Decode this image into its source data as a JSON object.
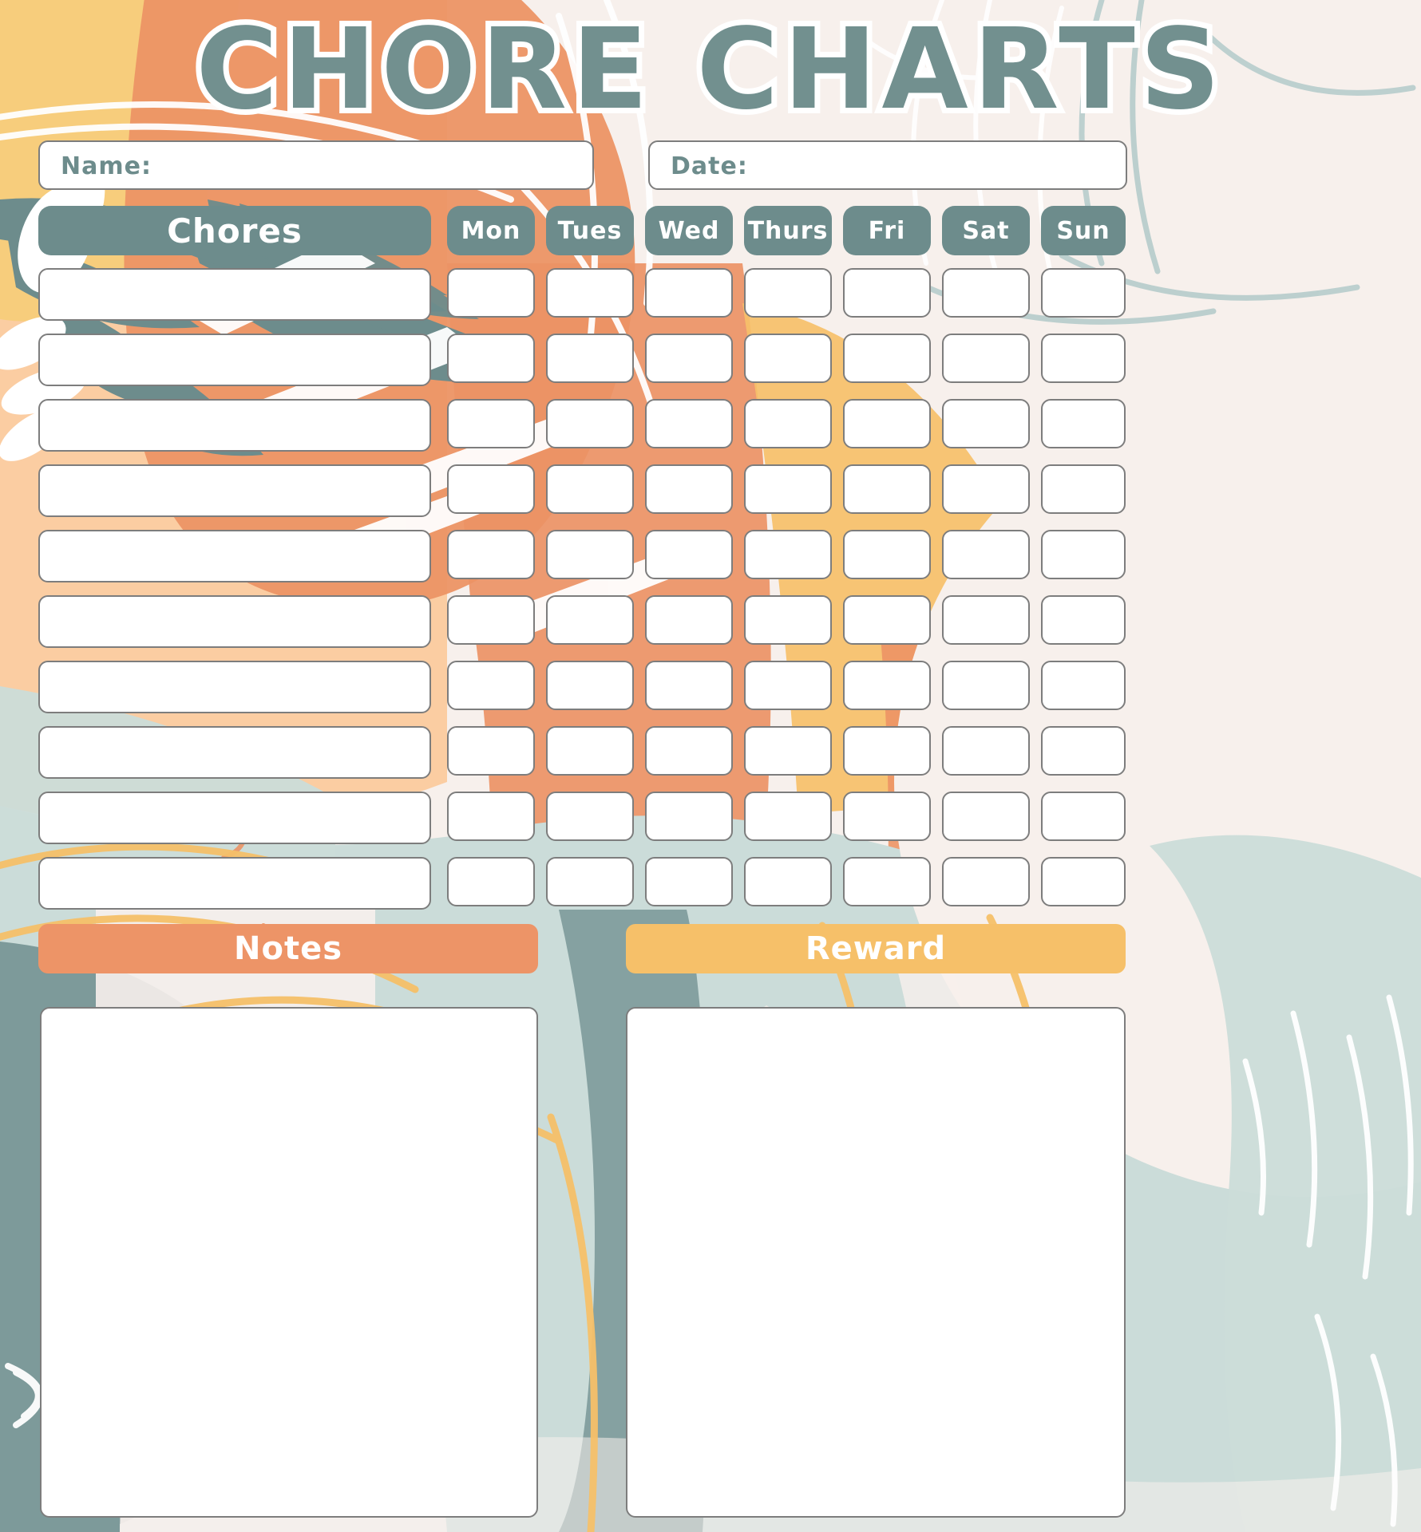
{
  "page": {
    "title": "CHORE CHARTS",
    "title_color": "#72908f",
    "title_outline_color": "#ffffff"
  },
  "fields": {
    "name_label": "Name:",
    "date_label": "Date:"
  },
  "table": {
    "chores_header": "Chores",
    "day_headers": [
      "Mon",
      "Tues",
      "Wed",
      "Thurs",
      "Fri",
      "Sat",
      "Sun"
    ],
    "row_count": 10,
    "chore_rows": [
      "",
      "",
      "",
      "",
      "",
      "",
      "",
      "",
      "",
      ""
    ],
    "header_color": "#6d8c8c",
    "cell_fill": "#ffffff",
    "cell_border": "#7d7d7d"
  },
  "bottom": {
    "notes_label": "Notes",
    "notes_color": "#ed9467",
    "notes_value": "",
    "reward_label": "Reward",
    "reward_color": "#f6c069",
    "reward_value": ""
  },
  "palette": {
    "cream": "#f7f0ec",
    "peach_light": "#fbcda2",
    "orange": "#ec9365",
    "yellow": "#f6c069",
    "yellow_light": "#f7cd7c",
    "teal": "#6d8c8c",
    "blue_grey": "#cbdcd9",
    "white": "#ffffff"
  }
}
